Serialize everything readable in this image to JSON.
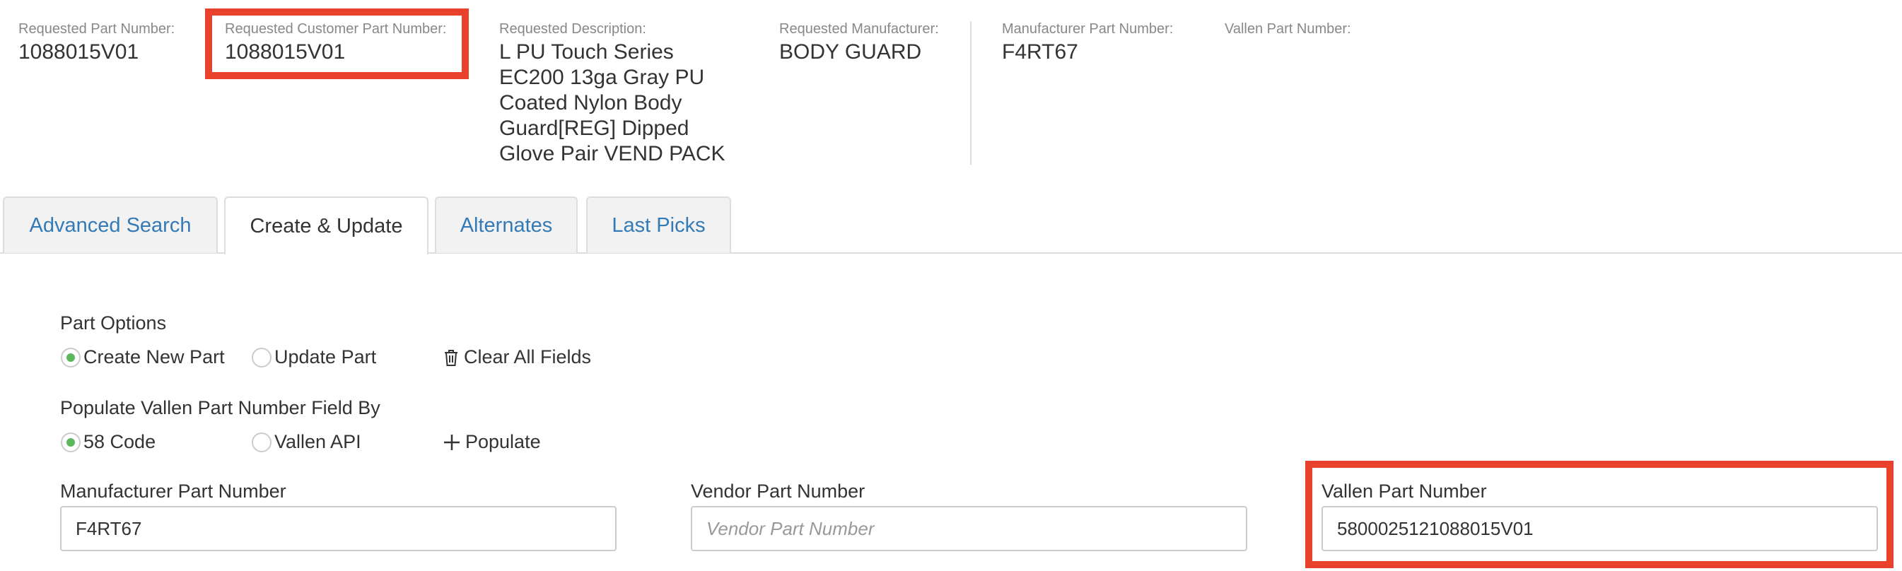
{
  "summary": {
    "requested_part_number": {
      "label": "Requested Part Number:",
      "value": "1088015V01"
    },
    "requested_customer_part_number": {
      "label": "Requested Customer Part Number:",
      "value": "1088015V01"
    },
    "requested_description": {
      "label": "Requested Description:",
      "value": "L PU Touch Series EC200 13ga Gray PU Coated Nylon Body Guard[REG] Dipped Glove Pair VEND PACK"
    },
    "requested_manufacturer": {
      "label": "Requested Manufacturer:",
      "value": "BODY GUARD"
    },
    "manufacturer_part_number": {
      "label": "Manufacturer Part Number:",
      "value": "F4RT67"
    },
    "vallen_part_number": {
      "label": "Vallen Part Number:",
      "value": ""
    }
  },
  "tabs": [
    {
      "label": "Advanced Search",
      "active": false
    },
    {
      "label": "Create & Update",
      "active": true
    },
    {
      "label": "Alternates",
      "active": false
    },
    {
      "label": "Last Picks",
      "active": false
    }
  ],
  "form": {
    "part_options": {
      "label": "Part Options",
      "options": [
        {
          "label": "Create New Part",
          "checked": true
        },
        {
          "label": "Update Part",
          "checked": false
        }
      ],
      "clear_label": "Clear All Fields"
    },
    "populate_by": {
      "label": "Populate Vallen Part Number Field By",
      "options": [
        {
          "label": "58 Code",
          "checked": true
        },
        {
          "label": "Vallen API",
          "checked": false
        }
      ],
      "populate_label": "Populate"
    },
    "fields": {
      "manufacturer_part_number": {
        "label": "Manufacturer Part Number",
        "value": "F4RT67",
        "placeholder": ""
      },
      "vendor_part_number": {
        "label": "Vendor Part Number",
        "value": "",
        "placeholder": "Vendor Part Number"
      },
      "vallen_part_number": {
        "label": "Vallen Part Number",
        "value": "5800025121088015V01",
        "placeholder": ""
      }
    }
  },
  "icons": {
    "clear": "trash-icon",
    "populate": "plus-icon"
  },
  "colors": {
    "link": "#337ab7",
    "radio_checked": "#5cb85c",
    "highlight": "#e8412c",
    "label_muted": "#888888"
  }
}
